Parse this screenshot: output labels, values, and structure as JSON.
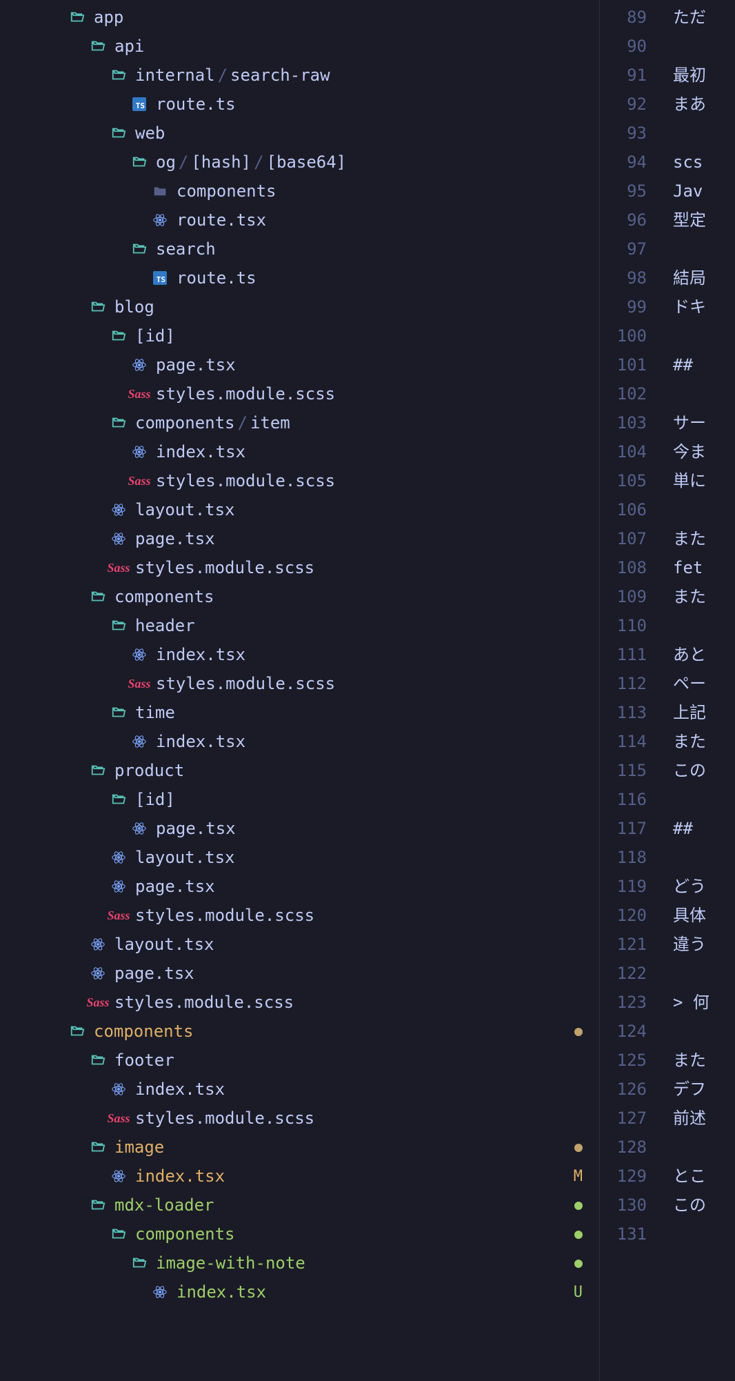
{
  "tree": [
    {
      "depth": 0,
      "icon": "folder-open",
      "label": "app"
    },
    {
      "depth": 1,
      "icon": "folder-open",
      "label": "api"
    },
    {
      "depth": 2,
      "icon": "folder-open",
      "labelParts": [
        "internal",
        "search-raw"
      ]
    },
    {
      "depth": 3,
      "icon": "ts",
      "label": "route.ts"
    },
    {
      "depth": 2,
      "icon": "folder-open",
      "label": "web"
    },
    {
      "depth": 3,
      "icon": "folder-open",
      "labelParts": [
        "og",
        "[hash]",
        "[base64]"
      ]
    },
    {
      "depth": 4,
      "icon": "folder-closed",
      "label": "components"
    },
    {
      "depth": 4,
      "icon": "react",
      "label": "route.tsx"
    },
    {
      "depth": 3,
      "icon": "folder-open",
      "label": "search"
    },
    {
      "depth": 4,
      "icon": "ts",
      "label": "route.ts"
    },
    {
      "depth": 1,
      "icon": "folder-open",
      "label": "blog"
    },
    {
      "depth": 2,
      "icon": "folder-open",
      "label": "[id]"
    },
    {
      "depth": 3,
      "icon": "react",
      "label": "page.tsx"
    },
    {
      "depth": 3,
      "icon": "sass",
      "label": "styles.module.scss"
    },
    {
      "depth": 2,
      "icon": "folder-open",
      "labelParts": [
        "components",
        "item"
      ]
    },
    {
      "depth": 3,
      "icon": "react",
      "label": "index.tsx"
    },
    {
      "depth": 3,
      "icon": "sass",
      "label": "styles.module.scss"
    },
    {
      "depth": 2,
      "icon": "react",
      "label": "layout.tsx"
    },
    {
      "depth": 2,
      "icon": "react",
      "label": "page.tsx"
    },
    {
      "depth": 2,
      "icon": "sass",
      "label": "styles.module.scss"
    },
    {
      "depth": 1,
      "icon": "folder-open",
      "label": "components"
    },
    {
      "depth": 2,
      "icon": "folder-open",
      "label": "header"
    },
    {
      "depth": 3,
      "icon": "react",
      "label": "index.tsx"
    },
    {
      "depth": 3,
      "icon": "sass",
      "label": "styles.module.scss"
    },
    {
      "depth": 2,
      "icon": "folder-open",
      "label": "time"
    },
    {
      "depth": 3,
      "icon": "react",
      "label": "index.tsx"
    },
    {
      "depth": 1,
      "icon": "folder-open",
      "label": "product"
    },
    {
      "depth": 2,
      "icon": "folder-open",
      "label": "[id]"
    },
    {
      "depth": 3,
      "icon": "react",
      "label": "page.tsx"
    },
    {
      "depth": 2,
      "icon": "react",
      "label": "layout.tsx"
    },
    {
      "depth": 2,
      "icon": "react",
      "label": "page.tsx"
    },
    {
      "depth": 2,
      "icon": "sass",
      "label": "styles.module.scss"
    },
    {
      "depth": 1,
      "icon": "react",
      "label": "layout.tsx"
    },
    {
      "depth": 1,
      "icon": "react",
      "label": "page.tsx"
    },
    {
      "depth": 1,
      "icon": "sass",
      "label": "styles.module.scss"
    },
    {
      "depth": 0,
      "icon": "folder-open",
      "label": "components",
      "mod": "modified",
      "status": "dot-yellow"
    },
    {
      "depth": 1,
      "icon": "folder-open",
      "label": "footer"
    },
    {
      "depth": 2,
      "icon": "react",
      "label": "index.tsx"
    },
    {
      "depth": 2,
      "icon": "sass",
      "label": "styles.module.scss"
    },
    {
      "depth": 1,
      "icon": "folder-open",
      "label": "image",
      "mod": "modified",
      "status": "dot-yellow"
    },
    {
      "depth": 2,
      "icon": "react",
      "label": "index.tsx",
      "mod": "modified",
      "status": "M"
    },
    {
      "depth": 1,
      "icon": "folder-open",
      "label": "mdx-loader",
      "mod": "added",
      "status": "dot-green"
    },
    {
      "depth": 2,
      "icon": "folder-open",
      "label": "components",
      "mod": "added",
      "status": "dot-green"
    },
    {
      "depth": 3,
      "icon": "folder-open",
      "label": "image-with-note",
      "mod": "added",
      "status": "dot-green"
    },
    {
      "depth": 4,
      "icon": "react",
      "label": "index.tsx",
      "mod": "added",
      "status": "U"
    }
  ],
  "editor": {
    "startLine": 89,
    "lines": [
      {
        "n": 89,
        "t": "ただ",
        "cls": ""
      },
      {
        "n": 90,
        "t": "",
        "cls": ""
      },
      {
        "n": 91,
        "t": "最初",
        "cls": ""
      },
      {
        "n": 92,
        "t": "まあ",
        "cls": ""
      },
      {
        "n": 93,
        "t": "",
        "cls": ""
      },
      {
        "n": 94,
        "t": "scs",
        "cls": ""
      },
      {
        "n": 95,
        "t": "Jav",
        "cls": ""
      },
      {
        "n": 96,
        "t": "型定",
        "cls": ""
      },
      {
        "n": 97,
        "t": "",
        "cls": ""
      },
      {
        "n": 98,
        "t": "結局",
        "cls": ""
      },
      {
        "n": 99,
        "t": "ドキ",
        "cls": ""
      },
      {
        "n": 100,
        "t": "",
        "cls": ""
      },
      {
        "n": 101,
        "t": "## ",
        "cls": "hl-purple"
      },
      {
        "n": 102,
        "t": "",
        "cls": ""
      },
      {
        "n": 103,
        "t": "サー",
        "cls": ""
      },
      {
        "n": 104,
        "t": "今ま",
        "cls": ""
      },
      {
        "n": 105,
        "t": "単に",
        "cls": ""
      },
      {
        "n": 106,
        "t": "",
        "cls": ""
      },
      {
        "n": 107,
        "t": "また",
        "cls": ""
      },
      {
        "n": 108,
        "t": "fet",
        "cls": ""
      },
      {
        "n": 109,
        "t": "また",
        "cls": ""
      },
      {
        "n": 110,
        "t": "",
        "cls": ""
      },
      {
        "n": 111,
        "t": "あと",
        "cls": ""
      },
      {
        "n": 112,
        "t": "ペー",
        "cls": ""
      },
      {
        "n": 113,
        "t": "上記",
        "cls": ""
      },
      {
        "n": 114,
        "t": "また",
        "cls": ""
      },
      {
        "n": 115,
        "t": "この",
        "cls": ""
      },
      {
        "n": 116,
        "t": "",
        "cls": ""
      },
      {
        "n": 117,
        "t": "## ",
        "cls": "hl-purple"
      },
      {
        "n": 118,
        "t": "",
        "cls": ""
      },
      {
        "n": 119,
        "t": "どう",
        "cls": ""
      },
      {
        "n": 120,
        "t": "具体",
        "cls": ""
      },
      {
        "n": 121,
        "t": "違う",
        "cls": ""
      },
      {
        "n": 122,
        "t": "",
        "cls": ""
      },
      {
        "n": 123,
        "t": "> 何",
        "cls": "hl-yellow"
      },
      {
        "n": 124,
        "t": "",
        "cls": ""
      },
      {
        "n": 125,
        "t": "また",
        "cls": ""
      },
      {
        "n": 126,
        "t": "デフ",
        "cls": ""
      },
      {
        "n": 127,
        "t": "前述",
        "cls": ""
      },
      {
        "n": 128,
        "t": "",
        "cls": ""
      },
      {
        "n": 129,
        "t": "とこ",
        "cls": ""
      },
      {
        "n": 130,
        "t": "この",
        "cls": ""
      },
      {
        "n": 131,
        "t": "",
        "cls": ""
      }
    ]
  }
}
